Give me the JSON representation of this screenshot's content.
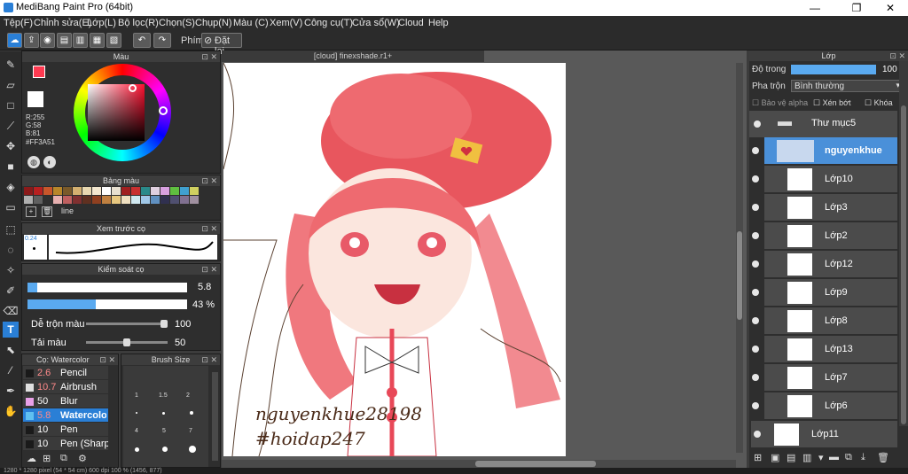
{
  "window": {
    "title": "MediBang Paint Pro (64bit)",
    "minimize": "—",
    "maximize": "❐",
    "close": "✕"
  },
  "menu": [
    "Tệp(F)",
    "Chỉnh sửa(E)",
    "Lớp(L)",
    "Bộ lọc(R)",
    "Chọn(S)",
    "Chụp(N)",
    "Màu (C)",
    "Xem(V)",
    "Công cụ(T)",
    "Cửa sổ(W)",
    "Cloud",
    "Help"
  ],
  "toolbar": {
    "shortcut_label": "Phím",
    "reset_label": "Đặt lại"
  },
  "color_panel": {
    "title": "Màu",
    "rgb": {
      "r": "R:255",
      "g": "G:58",
      "b": "B:81"
    },
    "hex": "#FF3A51",
    "primary_color": "#ff3a51"
  },
  "palette_panel": {
    "title": "Bảng màu",
    "swatches": [
      "#8a1a1a",
      "#b82020",
      "#c8562b",
      "#b8862a",
      "#7a5a2a",
      "#d4b070",
      "#e8d8b0",
      "#f4e8d0",
      "#ffffff",
      "#e8e0d0",
      "#a02020",
      "#c83030",
      "#2a8a8a",
      "#e0d0e0",
      "#d8a0e0",
      "#60c040",
      "#40a0d0",
      "#d0d060",
      "#b0b0b0",
      "#606060",
      "#303030",
      "#e8b0b0",
      "#c06060",
      "#803030",
      "#603020",
      "#904020",
      "#c08040",
      "#e8c880",
      "#f0e0c0",
      "#d0e8f0",
      "#a0c8e8",
      "#6090c0",
      "#303050",
      "#505070",
      "#807090",
      "#a090a0"
    ],
    "label": "line"
  },
  "brush_preview": {
    "title": "Xem trước cọ",
    "size_label": "0.24"
  },
  "brush_control": {
    "title": "Kiểm soát cọ",
    "size_value": "5.8",
    "size_fraction": 0.06,
    "opacity_value": "43 %",
    "opacity_fraction": 0.43,
    "blend_label": "Dễ trộn màu",
    "blend_value": "100",
    "amount_label": "Tải màu",
    "amount_value": "50"
  },
  "brush_list": {
    "title": "Cọ: Watercolor",
    "items": [
      {
        "size": "2.6",
        "name": "Pencil",
        "color": "#1a1a1a"
      },
      {
        "size": "10.7",
        "name": "Airbrush",
        "color": "#e0e0e0"
      },
      {
        "size": "50",
        "name": "Blur",
        "color": "#e8a0e8"
      },
      {
        "size": "5.8",
        "name": "Watercolor",
        "color": "#60c0f0"
      },
      {
        "size": "10",
        "name": "Pen",
        "color": "#1a1a1a"
      },
      {
        "size": "10",
        "name": "Pen (Sharp)",
        "color": "#1a1a1a"
      }
    ]
  },
  "brush_size": {
    "title": "Brush Size",
    "labels": [
      "1",
      "1.5",
      "2",
      "4",
      "5",
      "7"
    ]
  },
  "canvas": {
    "tab_title": "[cloud] finexshade.r1+",
    "signature_line1": "nguyenkhue28198",
    "signature_line2": "#hoidap247"
  },
  "layer_panel": {
    "title": "Lớp",
    "opacity_label": "Độ trong",
    "opacity_value": "100 %",
    "opacity_fraction": 1.0,
    "blend_label": "Pha trộn",
    "blend_value": "Bình thường",
    "protect_alpha": "Bảo vệ alpha",
    "clip": "Xén bớt",
    "lock": "Khóa",
    "folder_name": "Thư mục5",
    "layers": [
      "nguyenkhue",
      "Lớp10",
      "Lớp3",
      "Lớp2",
      "Lớp12",
      "Lớp9",
      "Lớp8",
      "Lớp13",
      "Lớp7",
      "Lớp6"
    ],
    "bottom_layer": "Lớp11"
  },
  "status": {
    "text": "1280 * 1280 pixel (54 * 54 cm) 600 dpi 100 % (1456, 877)"
  }
}
